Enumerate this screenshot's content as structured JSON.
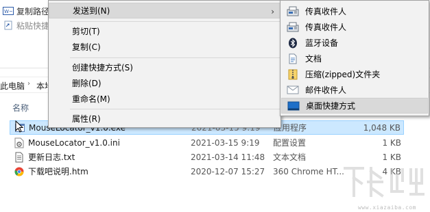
{
  "ribbon": {
    "copy_path_label": "复制路径",
    "paste_shortcut_label": "粘贴快捷"
  },
  "breadcrumb": {
    "this_pc": "此电脑",
    "local": "本地"
  },
  "file_list": {
    "name_header": "名称",
    "files": [
      {
        "name": "MouseLocator_v1.0.exe",
        "date": "2021-03-15 9:19",
        "type": "应用程序",
        "size": "1,048 KB",
        "icon": "app-exe-icon",
        "selected": true
      },
      {
        "name": "MouseLocator_v1.0.ini",
        "date": "2021-03-15 9:19",
        "type": "配置设置",
        "size": "1 KB",
        "icon": "config-file-icon",
        "selected": false
      },
      {
        "name": "更新日志.txt",
        "date": "2021-03-14 11:48",
        "type": "文本文档",
        "size": "1 KB",
        "icon": "text-file-icon",
        "selected": false
      },
      {
        "name": "下载吧说明.htm",
        "date": "2020-12-07 15:27",
        "type": "360 Chrome HT...",
        "size": "4 KB",
        "icon": "chrome-html-icon",
        "selected": false
      }
    ]
  },
  "context_menu": {
    "send_to": "发送到(N)",
    "cut": "剪切(T)",
    "copy": "复制(C)",
    "create_shortcut": "创建快捷方式(S)",
    "delete": "删除(D)",
    "rename": "重命名(M)",
    "properties": "属性(R)"
  },
  "send_to_menu": {
    "items": [
      {
        "label": "传真收件人",
        "icon": "fax-icon"
      },
      {
        "label": "传真收件人",
        "icon": "fax-icon"
      },
      {
        "label": "蓝牙设备",
        "icon": "bluetooth-icon"
      },
      {
        "label": "文档",
        "icon": "documents-icon"
      },
      {
        "label": "压缩(zipped)文件夹",
        "icon": "zip-folder-icon"
      },
      {
        "label": "邮件收件人",
        "icon": "mail-icon"
      },
      {
        "label": "桌面快捷方式",
        "icon": "desktop-icon"
      }
    ]
  },
  "watermark": {
    "url": "www.xiazaiba.com"
  },
  "colors": {
    "selection_bg": "#cce8ff",
    "menu_bg": "#f2f2f2",
    "menu_hover": "#d9d9d9",
    "column_header": "#4c607a"
  }
}
